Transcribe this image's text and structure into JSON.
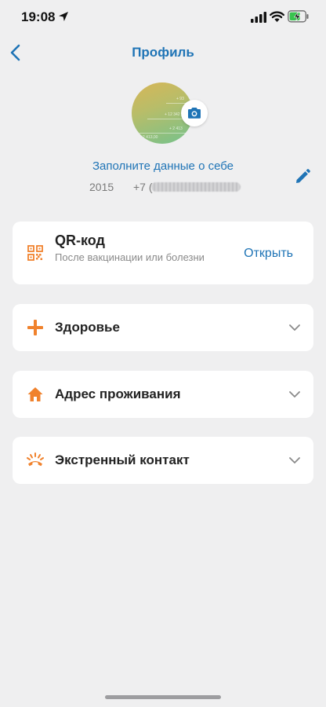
{
  "status_bar": {
    "time": "19:08",
    "icons": [
      "location-arrow-icon",
      "signal-icon",
      "wifi-icon",
      "battery-charging-icon"
    ]
  },
  "nav": {
    "title": "Профиль",
    "back_icon": "chevron-left-icon"
  },
  "profile": {
    "avatar_numbers": [
      "+ 93",
      "+ 12 342",
      "+ 2 413",
      "2 413,00"
    ],
    "camera_icon": "camera-icon",
    "fill_link": "Заполните данные о себе",
    "edit_icon": "pencil-icon",
    "year": "2015",
    "phone_prefix": "+7 ("
  },
  "qr_card": {
    "icon": "qr-code-icon",
    "title": "QR-код",
    "subtitle": "После вакцинации или болезни",
    "action": "Открыть"
  },
  "sections": [
    {
      "label": "Здоровье",
      "icon": "plus-icon"
    },
    {
      "label": "Адрес проживания",
      "icon": "home-icon"
    },
    {
      "label": "Экстренный контакт",
      "icon": "emergency-phone-icon"
    }
  ],
  "colors": {
    "accent_blue": "#1f74b6",
    "accent_orange": "#f0822d",
    "background": "#efeff0",
    "card": "#ffffff"
  }
}
